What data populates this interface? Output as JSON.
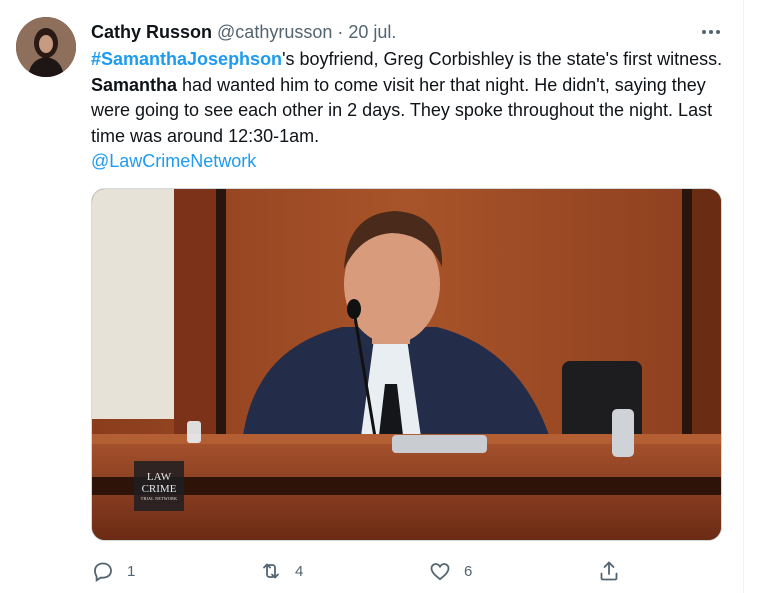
{
  "tweet": {
    "author_name": "Cathy Russon",
    "handle": "@cathyrusson",
    "separator": "·",
    "date": "20 jul.",
    "text": {
      "hashtag": "#SamanthaJosephson",
      "part1": "'s boyfriend, Greg Corbishley is the state's first witness.  ",
      "bold": "Samantha",
      "part2": " had wanted him to come visit her that night. He didn't, saying they were going to see each other in 2 days. They spoke throughout the night. Last time was around 12:30-1am.",
      "mention": "@LawCrimeNetwork"
    },
    "media": {
      "watermark_line1": "LAW",
      "watermark_line2": "CRIME",
      "watermark_line3": "TRIAL NETWORK"
    },
    "actions": {
      "replies": "1",
      "retweets": "4",
      "likes": "6"
    }
  },
  "icons": {
    "more": "more-icon",
    "reply": "reply-icon",
    "retweet": "retweet-icon",
    "like": "heart-icon",
    "share": "share-icon"
  },
  "colors": {
    "link": "#1d9bf0",
    "muted": "#536471",
    "text": "#0f1419"
  }
}
